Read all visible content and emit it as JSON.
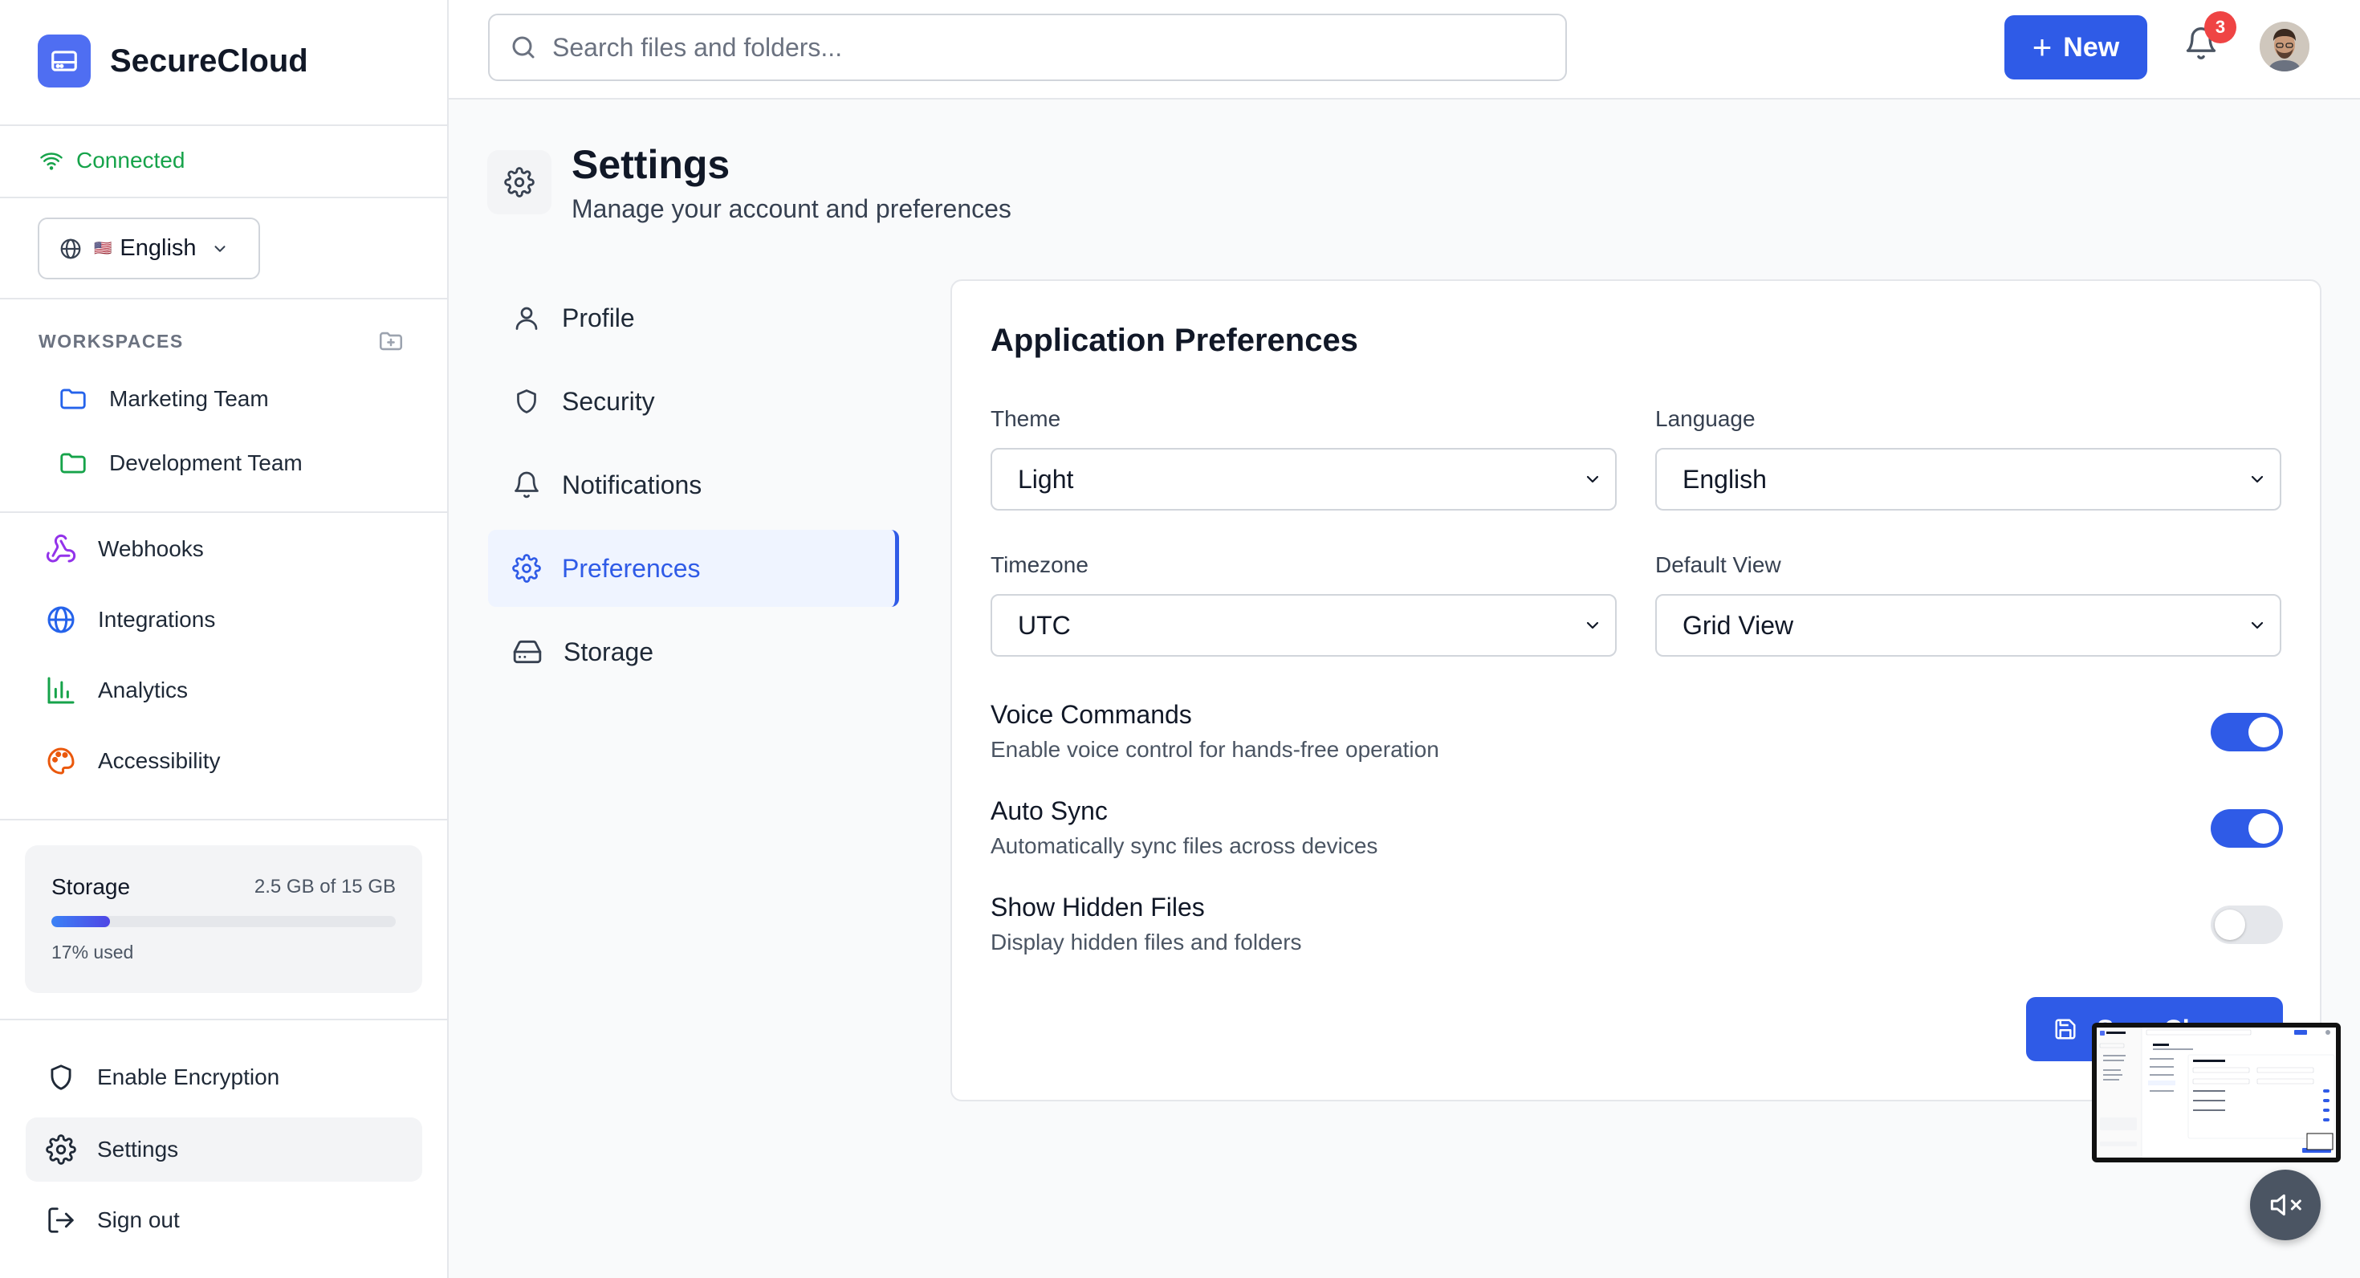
{
  "app": {
    "name": "SecureCloud"
  },
  "sidebar": {
    "connection_status": "Connected",
    "language": {
      "flag": "🇺🇸",
      "label": "English"
    },
    "workspaces_heading": "WORKSPACES",
    "workspaces": [
      {
        "label": "Marketing Team",
        "color": "#2563eb"
      },
      {
        "label": "Development Team",
        "color": "#16a34a"
      }
    ],
    "nav": [
      {
        "label": "Webhooks",
        "icon": "webhook-icon"
      },
      {
        "label": "Integrations",
        "icon": "globe-icon"
      },
      {
        "label": "Analytics",
        "icon": "bar-chart-icon"
      },
      {
        "label": "Accessibility",
        "icon": "palette-icon"
      }
    ],
    "storage": {
      "label": "Storage",
      "amount": "2.5 GB of 15 GB",
      "percent": 17,
      "percent_label": "17% used"
    },
    "bottom": [
      {
        "label": "Enable Encryption",
        "icon": "shield-icon"
      },
      {
        "label": "Settings",
        "icon": "gear-icon",
        "active": true
      },
      {
        "label": "Sign out",
        "icon": "sign-out-icon"
      }
    ]
  },
  "topbar": {
    "search_placeholder": "Search files and folders...",
    "new_label": "New",
    "notification_count": "3"
  },
  "page": {
    "title": "Settings",
    "subtitle": "Manage your account and preferences"
  },
  "settings_nav": [
    {
      "label": "Profile",
      "icon": "user-icon"
    },
    {
      "label": "Security",
      "icon": "shield-icon"
    },
    {
      "label": "Notifications",
      "icon": "bell-icon"
    },
    {
      "label": "Preferences",
      "icon": "gear-icon",
      "active": true
    },
    {
      "label": "Storage",
      "icon": "hard-drive-icon"
    }
  ],
  "preferences": {
    "title": "Application Preferences",
    "theme": {
      "label": "Theme",
      "value": "Light"
    },
    "language": {
      "label": "Language",
      "value": "English"
    },
    "timezone": {
      "label": "Timezone",
      "value": "UTC"
    },
    "default_view": {
      "label": "Default View",
      "value": "Grid View"
    },
    "toggles": [
      {
        "title": "Voice Commands",
        "description": "Enable voice control for hands-free operation",
        "on": true
      },
      {
        "title": "Auto Sync",
        "description": "Automatically sync files across devices",
        "on": true
      },
      {
        "title": "Show Hidden Files",
        "description": "Display hidden files and folders",
        "on": false
      }
    ],
    "save_label": "Save Changes"
  },
  "colors": {
    "accent": "#2f5be7",
    "brand": "#4f6ef2",
    "connected": "#16a34a",
    "badge": "#ef4444"
  }
}
